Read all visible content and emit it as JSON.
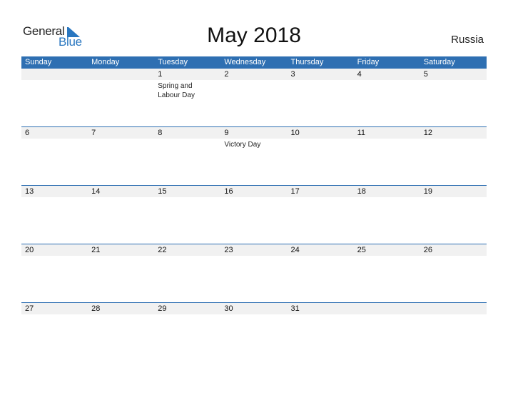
{
  "logo": {
    "text1": "General",
    "text2": "Blue"
  },
  "title": "May 2018",
  "country": "Russia",
  "colors": {
    "header": "#2e6fb2",
    "date_strip": "#f1f1f1",
    "brand_blue": "#2a77c0"
  },
  "weekdays": [
    "Sunday",
    "Monday",
    "Tuesday",
    "Wednesday",
    "Thursday",
    "Friday",
    "Saturday"
  ],
  "weeks": [
    {
      "dates": [
        "",
        "",
        "1",
        "2",
        "3",
        "4",
        "5"
      ],
      "events": [
        "",
        "",
        "Spring and Labour Day",
        "",
        "",
        "",
        ""
      ]
    },
    {
      "dates": [
        "6",
        "7",
        "8",
        "9",
        "10",
        "11",
        "12"
      ],
      "events": [
        "",
        "",
        "",
        "Victory Day",
        "",
        "",
        ""
      ]
    },
    {
      "dates": [
        "13",
        "14",
        "15",
        "16",
        "17",
        "18",
        "19"
      ],
      "events": [
        "",
        "",
        "",
        "",
        "",
        "",
        ""
      ]
    },
    {
      "dates": [
        "20",
        "21",
        "22",
        "23",
        "24",
        "25",
        "26"
      ],
      "events": [
        "",
        "",
        "",
        "",
        "",
        "",
        ""
      ]
    },
    {
      "dates": [
        "27",
        "28",
        "29",
        "30",
        "31",
        "",
        ""
      ],
      "events": [
        "",
        "",
        "",
        "",
        "",
        "",
        ""
      ]
    }
  ]
}
